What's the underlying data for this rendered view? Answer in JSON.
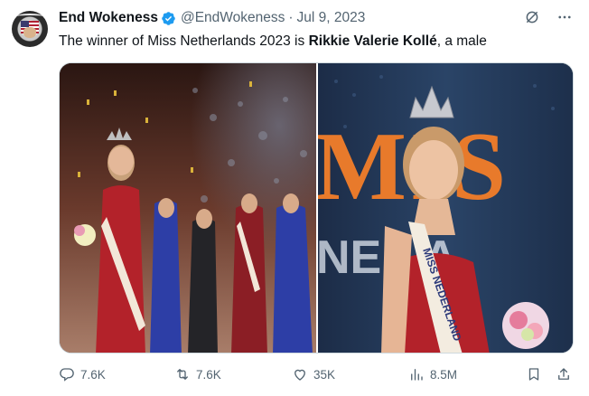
{
  "tweet": {
    "display_name": "End Wokeness",
    "handle": "@EndWokeness",
    "separator": "·",
    "date": "Jul 9, 2023",
    "text_prefix": "The winner of Miss Netherlands 2023 is ",
    "text_bold": "Rikkie Valerie Kollé",
    "text_suffix": ", a male"
  },
  "media": {
    "left_image": {
      "sash_text": ""
    },
    "right_image": {
      "backdrop_text_top": "MIS",
      "backdrop_text_bottom": "NE    LA",
      "sash_text": "MISS NEDERLAND"
    }
  },
  "actions": {
    "replies": "7.6K",
    "retweets": "7.6K",
    "likes": "35K",
    "views": "8.5M"
  },
  "colors": {
    "verified_blue": "#1d9bf0",
    "secondary_text": "#536471",
    "primary_text": "#0f1419",
    "border": "#cfd9de"
  },
  "icons": [
    "verified-icon",
    "grok-icon",
    "more-icon",
    "reply-icon",
    "retweet-icon",
    "like-icon",
    "views-icon",
    "bookmark-icon",
    "share-icon"
  ]
}
